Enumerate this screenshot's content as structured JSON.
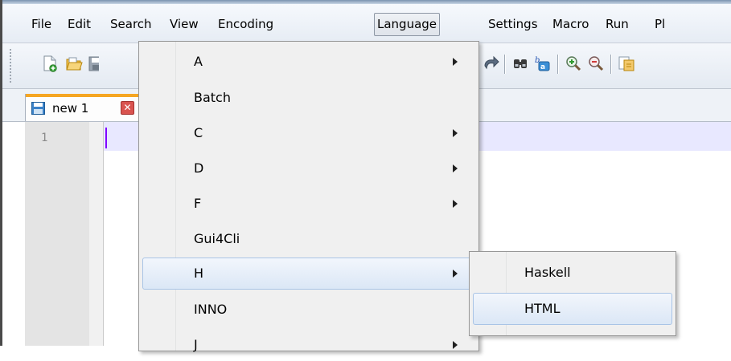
{
  "menubar": {
    "items": [
      "File",
      "Edit",
      "Search",
      "View",
      "Encoding",
      "Language",
      "Settings",
      "Macro",
      "Run",
      "Pl"
    ],
    "open_item": "Language"
  },
  "toolbar": {
    "buttons": [
      "new-file-icon",
      "open-file-icon",
      "save-icon",
      "redo-icon",
      "find-icon",
      "replace-icon",
      "zoom-in-icon",
      "zoom-out-icon",
      "sync-icon"
    ]
  },
  "tabs": [
    {
      "label": "new 1",
      "close_glyph": "✕"
    }
  ],
  "editor": {
    "line_numbers": [
      "1"
    ]
  },
  "language_menu": {
    "items": [
      {
        "label": "A",
        "has_submenu": true
      },
      {
        "label": "Batch",
        "has_submenu": false
      },
      {
        "label": "C",
        "has_submenu": true
      },
      {
        "label": "D",
        "has_submenu": true
      },
      {
        "label": "F",
        "has_submenu": true
      },
      {
        "label": "Gui4Cli",
        "has_submenu": false
      },
      {
        "label": "H",
        "has_submenu": true,
        "highlighted": true
      },
      {
        "label": "INNO",
        "has_submenu": false
      },
      {
        "label": "J",
        "has_submenu": true
      }
    ]
  },
  "h_submenu": {
    "items": [
      {
        "label": "Haskell",
        "highlighted": false
      },
      {
        "label": "HTML",
        "highlighted": true
      }
    ]
  },
  "colors": {
    "tab_accent": "#f5a623",
    "caret": "#8000ff",
    "current_line": "#e8e8ff",
    "menu_highlight_border": "#a9c4e6"
  }
}
